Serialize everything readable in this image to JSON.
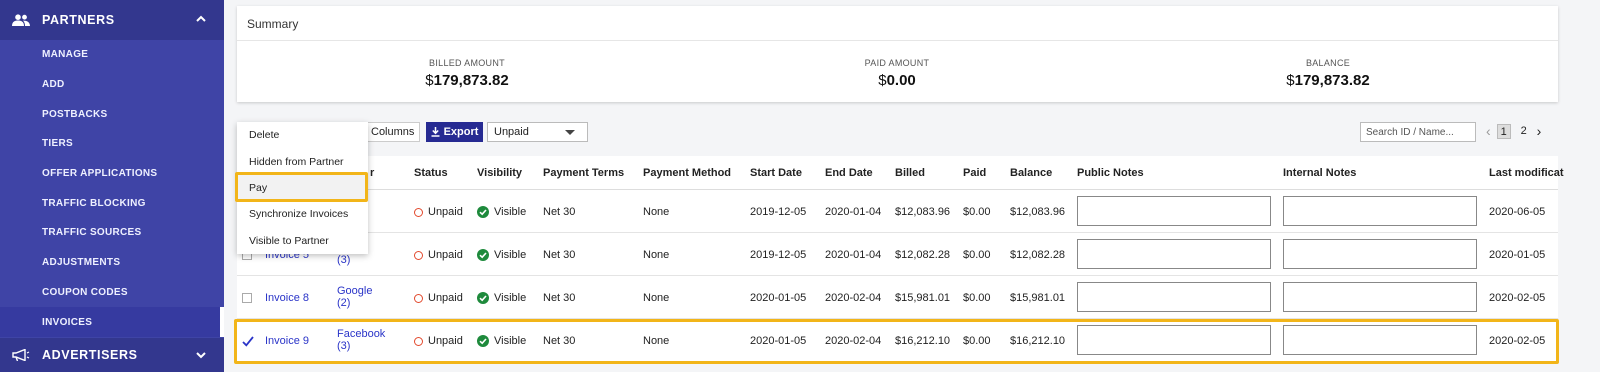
{
  "sidebar": {
    "partners_label": "PARTNERS",
    "items": [
      {
        "label": "MANAGE"
      },
      {
        "label": "ADD"
      },
      {
        "label": "POSTBACKS"
      },
      {
        "label": "TIERS"
      },
      {
        "label": "OFFER APPLICATIONS"
      },
      {
        "label": "TRAFFIC BLOCKING"
      },
      {
        "label": "TRAFFIC SOURCES"
      },
      {
        "label": "ADJUSTMENTS"
      },
      {
        "label": "COUPON CODES"
      },
      {
        "label": "INVOICES"
      }
    ],
    "active_item": "INVOICES",
    "advertisers_label": "ADVERTISERS"
  },
  "summary": {
    "title": "Summary",
    "metrics": [
      {
        "label": "BILLED AMOUNT",
        "currency": "$",
        "value": "179,873.82"
      },
      {
        "label": "PAID AMOUNT",
        "currency": "$",
        "value": "0.00"
      },
      {
        "label": "BALANCE",
        "currency": "$",
        "value": "179,873.82"
      }
    ]
  },
  "toolbar": {
    "columns_label": "Columns",
    "export_label": "Export",
    "status_filter": "Unpaid",
    "search_placeholder": "Search ID / Name...",
    "pages": [
      "1",
      "2"
    ],
    "current_page": "1"
  },
  "menu": {
    "items": [
      "Delete",
      "Hidden from Partner",
      "Pay",
      "Synchronize Invoices",
      "Visible to Partner"
    ],
    "highlighted": "Pay"
  },
  "table": {
    "headers": {
      "partner_partial": "r",
      "status": "Status",
      "visibility": "Visibility",
      "payment_terms": "Payment Terms",
      "payment_method": "Payment Method",
      "start_date": "Start Date",
      "end_date": "End Date",
      "billed": "Billed",
      "paid": "Paid",
      "balance": "Balance",
      "public_notes": "Public Notes",
      "internal_notes": "Internal Notes",
      "last_modified": "Last modificat"
    },
    "rows": [
      {
        "invoice": "",
        "partner_line1": "e",
        "partner_line2": "",
        "status": "Unpaid",
        "visibility": "Visible",
        "terms": "Net 30",
        "method": "None",
        "start": "2019-12-05",
        "end": "2020-01-04",
        "billed": "$12,083.96",
        "paid": "$0.00",
        "balance": "$12,083.96",
        "last_modified": "2020-06-05",
        "checked": false
      },
      {
        "invoice": "Invoice 5",
        "partner_line1": "ebook",
        "partner_line2": "(3)",
        "status": "Unpaid",
        "visibility": "Visible",
        "terms": "Net 30",
        "method": "None",
        "start": "2019-12-05",
        "end": "2020-01-04",
        "billed": "$12,082.28",
        "paid": "$0.00",
        "balance": "$12,082.28",
        "last_modified": "2020-01-05",
        "checked": false
      },
      {
        "invoice": "Invoice 8",
        "partner_line1": "Google",
        "partner_line2": "(2)",
        "status": "Unpaid",
        "visibility": "Visible",
        "terms": "Net 30",
        "method": "None",
        "start": "2020-01-05",
        "end": "2020-02-04",
        "billed": "$15,981.01",
        "paid": "$0.00",
        "balance": "$15,981.01",
        "last_modified": "2020-02-05",
        "checked": false
      },
      {
        "invoice": "Invoice 9",
        "partner_line1": "Facebook",
        "partner_line2": "(3)",
        "status": "Unpaid",
        "visibility": "Visible",
        "terms": "Net 30",
        "method": "None",
        "start": "2020-01-05",
        "end": "2020-02-04",
        "billed": "$16,212.10",
        "paid": "$0.00",
        "balance": "$16,212.10",
        "last_modified": "2020-02-05",
        "checked": true
      }
    ]
  },
  "colors": {
    "sidebar_bg": "#3f44a6",
    "sidebar_header_bg": "#33378e",
    "accent": "#262a92",
    "link": "#2a34c8",
    "highlight": "#f2b519",
    "unpaid_ring": "#e2492d",
    "visible_check": "#1e8a3c"
  }
}
